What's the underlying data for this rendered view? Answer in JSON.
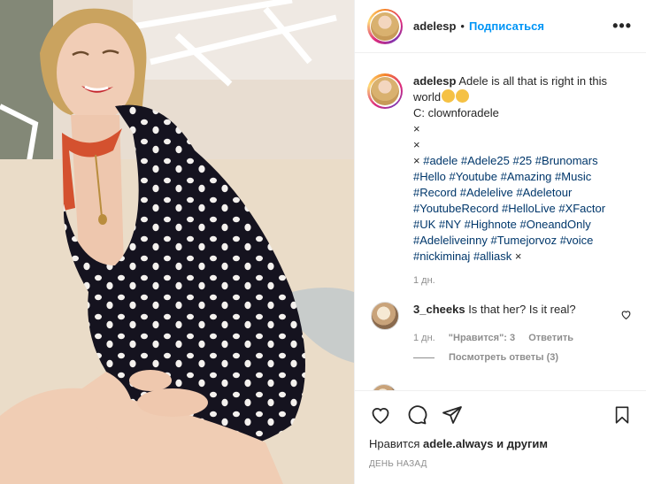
{
  "header": {
    "username": "adelesp",
    "separator": "•",
    "follow_label": "Подписаться",
    "more_icon": "more-horizontal-icon",
    "more_label": "•••"
  },
  "caption": {
    "username": "adelesp",
    "text": "Adele is all that is right in this world",
    "credit": "C: clownforadele",
    "x1": "×",
    "x2": "×",
    "x3": "×",
    "tags": [
      "#adele",
      "#Adele25",
      "#25",
      "#Brunomars",
      "#Hello",
      "#Youtube",
      "#Amazing",
      "#Music",
      "#Record",
      "#Adelelive",
      "#Adeletour",
      "#YoutubeRecord",
      "#HelloLive",
      "#XFactor",
      "#UK",
      "#NY",
      "#Highnote",
      "#OneandOnly",
      "#Adeleliveinny",
      "#Tumejorvoz",
      "#voice",
      "#nickiminaj",
      "#alliask"
    ],
    "trailing": "×",
    "time": "1 дн."
  },
  "comment": {
    "username": "3_cheeks",
    "text": "Is that her? Is it real?",
    "time": "1 дн.",
    "likes": "\"Нравится\": 3",
    "reply_label": "Ответить",
    "view_replies": "Посмотреть ответы (3)"
  },
  "actions": {
    "like_icon": "heart-icon",
    "comment_icon": "comment-icon",
    "share_icon": "paper-plane-icon",
    "save_icon": "bookmark-icon"
  },
  "likes": {
    "prefix": "Нравится",
    "user": "adele.always",
    "suffix": "и другим"
  },
  "posted": "День назад",
  "colors": {
    "accent": "#0095f6",
    "hashtag": "#00376b",
    "muted": "#8e8e8e",
    "dress": "#15131f"
  }
}
